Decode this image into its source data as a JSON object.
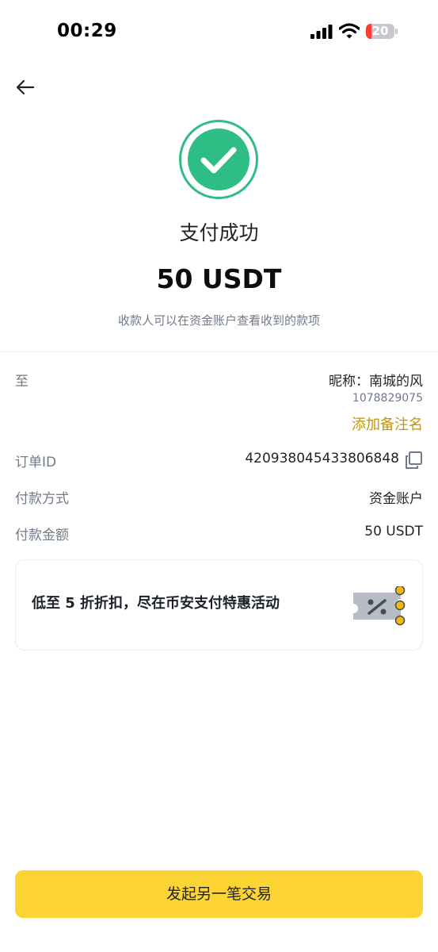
{
  "status_bar": {
    "time": "00:29",
    "battery_level": "20",
    "battery_fraction": 0.2,
    "icons": [
      "cellular-signal-icon",
      "wifi-icon",
      "battery-icon"
    ]
  },
  "nav": {
    "back_icon": "arrow-left-icon"
  },
  "result": {
    "status_icon": "check-circle-icon",
    "title": "支付成功",
    "amount": "50 USDT",
    "subtitle": "收款人可以在资金账户查看收到的款项"
  },
  "details": {
    "to_label": "至",
    "recipient_nickname": "昵称：南城的风",
    "recipient_id": "1078829075",
    "add_note": "添加备注名",
    "order_id_label": "订单ID",
    "order_id_value": "420938045433806848",
    "payment_method_label": "付款方式",
    "payment_method_value": "资金账户",
    "payment_amount_label": "付款金额",
    "payment_amount_value": "50 USDT"
  },
  "promo": {
    "text": "低至 5 折折扣，尽在币安支付特惠活动",
    "icon": "discount-coupon-icon"
  },
  "footer": {
    "primary_button": "发起另一笔交易"
  },
  "colors": {
    "success": "#2EBD85",
    "accent_yellow": "#FCD535",
    "link_gold": "#C99400",
    "battery_low": "#FF3B30",
    "text_primary": "#1E2329",
    "text_secondary": "#707A8A"
  }
}
